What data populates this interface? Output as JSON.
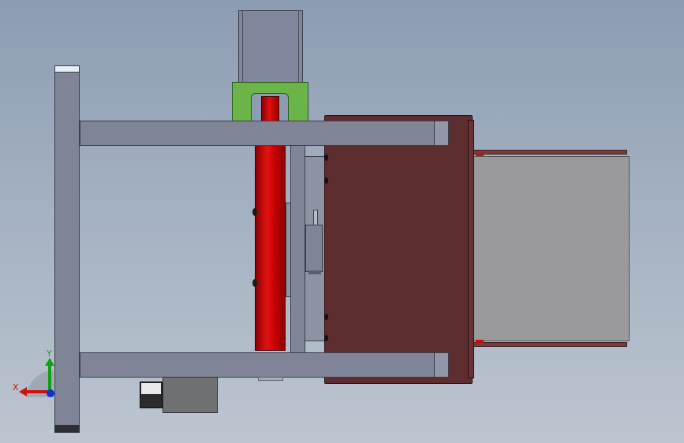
{
  "colors": {
    "background_top": "#8c9cb2",
    "background_bottom": "#bcc5d0",
    "frame": "#7f8497",
    "frame_edge": "#3b3e4a",
    "roller": "#d10000",
    "motor_mount": "#6ab44a",
    "plate": "#5e2d2f",
    "tray": "#9a999b",
    "gearbox": "#6f7072",
    "axis_x": "#d01010",
    "axis_y": "#10a010",
    "axis_z": "#1030d0"
  },
  "triad": {
    "x_label": "X",
    "y_label": "Y"
  }
}
